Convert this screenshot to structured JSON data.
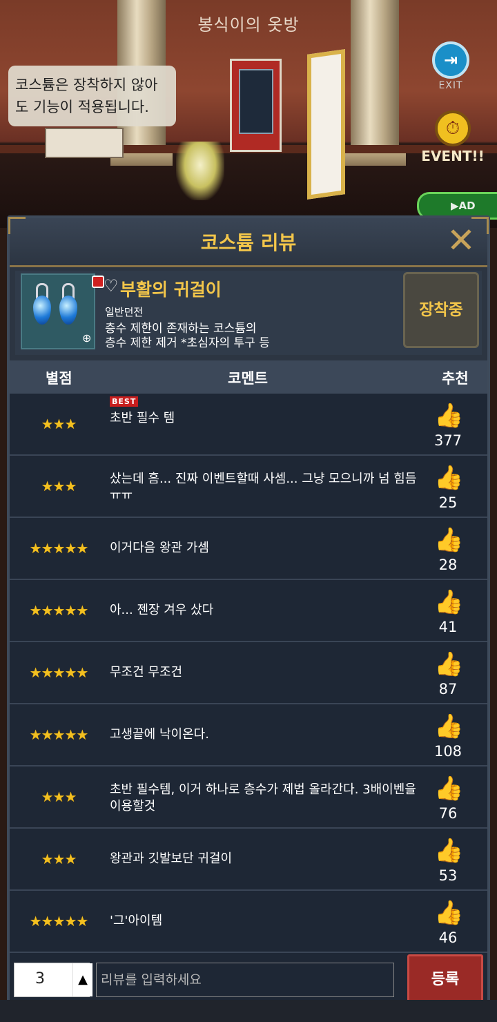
{
  "scene": {
    "title": "봉식이의 옷방",
    "tooltip_line1": "코스튬은 장착하지 않아",
    "tooltip_line2": "도 기능이 적용됩니다.",
    "exit_label": "EXIT",
    "event_label": "EVENT!!",
    "ad_label": "▶AD"
  },
  "panel": {
    "title": "코스튬 리뷰",
    "close_icon": "✕",
    "item": {
      "name": "부활의 귀걸이",
      "category": "일반던전",
      "desc_line1": "층수 제한이 존재하는 코스튬의",
      "desc_line2": "층수 제한 제거 *초심자의 투구 등",
      "equip_label": "장착중",
      "heart_icon": "♡",
      "zoom_icon": "⊕"
    },
    "columns": {
      "rating": "별점",
      "comment": "코멘트",
      "recommend": "추천"
    },
    "best_label": "BEST",
    "reviews": [
      {
        "stars": "★★★",
        "comment": "초반 필수 템",
        "likes": "377"
      },
      {
        "stars": "★★★",
        "comment": "샀는데 흠... 진짜 이벤트할때 사셈... 그냥 모으니까 넘  힘듬 ㅠㅠ",
        "likes": "25"
      },
      {
        "stars": "★★★★★",
        "comment": "이거다음 왕관 가셈",
        "likes": "28"
      },
      {
        "stars": "★★★★★",
        "comment": "아... 젠장 겨우 샀다",
        "likes": "41"
      },
      {
        "stars": "★★★★★",
        "comment": "무조건 무조건",
        "likes": "87"
      },
      {
        "stars": "★★★★★",
        "comment": "고생끝에 낙이온다.",
        "likes": "108"
      },
      {
        "stars": "★★★",
        "comment": "초반 필수템, 이거 하나로 층수가 제법 올라간다. 3배이벤을 이용할것",
        "likes": "76"
      },
      {
        "stars": "★★★",
        "comment": "왕관과 깃발보단 귀걸이",
        "likes": "53"
      },
      {
        "stars": "★★★★★",
        "comment": "'그'아이템",
        "likes": "46"
      }
    ],
    "thumb_icon": "👍",
    "input": {
      "rating_value": "3",
      "rating_up_icon": "▲",
      "placeholder": "리뷰를 입력하세요",
      "submit_label": "등록"
    }
  },
  "colors": {
    "accent_gold": "#f3c64a",
    "star": "#f3c020",
    "submit": "#9a2a26"
  }
}
